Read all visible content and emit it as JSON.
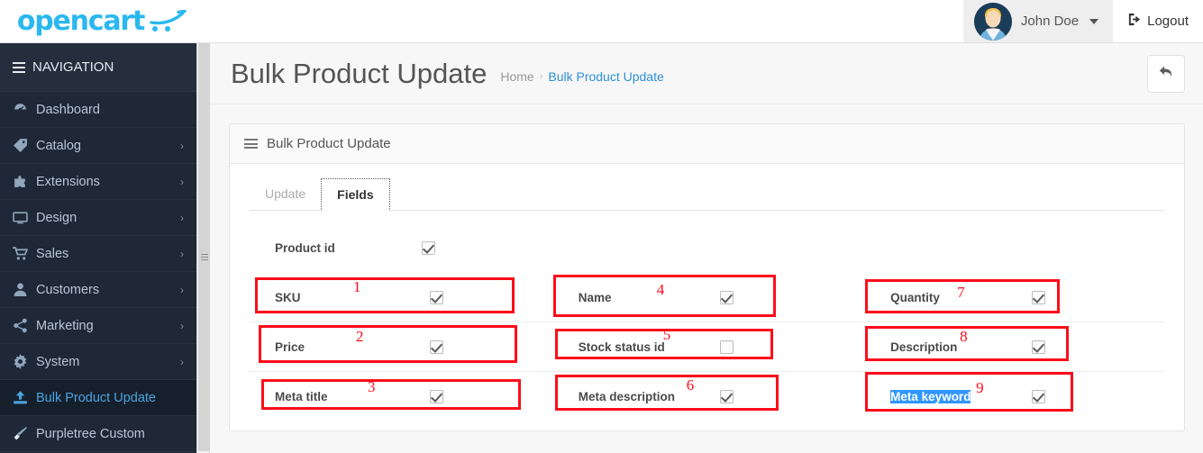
{
  "topbar": {
    "logo_text": "opencart",
    "logo_icon": "shopping-cart-swoosh-icon",
    "user_name": "John Doe",
    "logout_label": "Logout",
    "logout_icon": "logout-icon",
    "caret_icon": "caret-down-icon",
    "avatar_icon": "user-avatar"
  },
  "sidebar": {
    "nav_header": "NAVIGATION",
    "hamburger_icon": "hamburger-icon",
    "items": [
      {
        "label": "Dashboard",
        "icon": "dashboard-icon",
        "arrow": "",
        "active": false
      },
      {
        "label": "Catalog",
        "icon": "tag-icon",
        "arrow": "›",
        "active": false
      },
      {
        "label": "Extensions",
        "icon": "puzzle-icon",
        "arrow": "›",
        "active": false
      },
      {
        "label": "Design",
        "icon": "monitor-icon",
        "arrow": "›",
        "active": false
      },
      {
        "label": "Sales",
        "icon": "cart-icon",
        "arrow": "›",
        "active": false
      },
      {
        "label": "Customers",
        "icon": "user-icon",
        "arrow": "›",
        "active": false
      },
      {
        "label": "Marketing",
        "icon": "share-icon",
        "arrow": "›",
        "active": false
      },
      {
        "label": "System",
        "icon": "gear-icon",
        "arrow": "›",
        "active": false
      },
      {
        "label": "Bulk Product Update",
        "icon": "upload-icon",
        "arrow": "",
        "active": true
      },
      {
        "label": "Purpletree Custom",
        "icon": "brush-icon",
        "arrow": "",
        "active": false
      }
    ]
  },
  "page": {
    "title": "Bulk Product Update",
    "breadcrumb_home": "Home",
    "breadcrumb_sep": "›",
    "breadcrumb_current": "Bulk Product Update",
    "back_icon": "back-arrow-icon"
  },
  "panel": {
    "heading": "Bulk Product Update",
    "heading_icon": "list-icon",
    "tabs": [
      {
        "label": "Update",
        "active": false
      },
      {
        "label": "Fields",
        "active": true
      }
    ]
  },
  "fields": {
    "standalone": {
      "label": "Product id",
      "checked": true
    },
    "rows": [
      [
        {
          "label": "SKU",
          "checked": true,
          "anno": "1",
          "selected": false
        },
        {
          "label": "Name",
          "checked": true,
          "anno": "4",
          "selected": false
        },
        {
          "label": "Quantity",
          "checked": true,
          "anno": "7",
          "selected": false
        }
      ],
      [
        {
          "label": "Price",
          "checked": true,
          "anno": "2",
          "selected": false
        },
        {
          "label": "Stock status id",
          "checked": false,
          "anno": "5",
          "selected": false
        },
        {
          "label": "Description",
          "checked": true,
          "anno": "8",
          "selected": false
        }
      ],
      [
        {
          "label": "Meta title",
          "checked": true,
          "anno": "3",
          "selected": false
        },
        {
          "label": "Meta description",
          "checked": true,
          "anno": "6",
          "selected": false
        },
        {
          "label": "Meta keyword",
          "checked": true,
          "anno": "9",
          "selected": true
        }
      ]
    ]
  },
  "colors": {
    "brand": "#2bb8ef",
    "sidebar_bg": "#1f2836",
    "accent_link": "#2f8fd6",
    "annotation": "#fc0d1b",
    "selection": "#3297fd"
  }
}
